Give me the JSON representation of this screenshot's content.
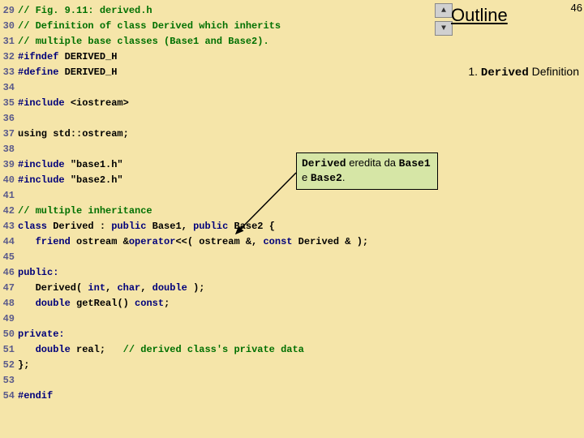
{
  "page_number": "46",
  "outline": {
    "title": "Outline"
  },
  "note1": {
    "prefix": "1. ",
    "code": "Derived",
    "suffix": " Definition"
  },
  "callout": {
    "w1": "Derived",
    "t1": " eredita da ",
    "w2": "Base1",
    "t2": " e ",
    "w3": "Base2",
    "t3": "."
  },
  "lines": {
    "l29": "// Fig. 9.11: derived.h",
    "l30": "// Definition of class Derived which inherits",
    "l31": "// multiple base classes (Base1 and Base2).",
    "l32a": "#ifndef ",
    "l32b": "DERIVED_H",
    "l33a": "#define ",
    "l33b": "DERIVED_H",
    "l35a": "#include ",
    "l35b": "<iostream>",
    "l37a": "using ",
    "l37b": "std::ostream;",
    "l39a": "#include ",
    "l39b": "\"base1.h\"",
    "l40a": "#include ",
    "l40b": "\"base2.h\"",
    "l42": "// multiple inheritance",
    "l43a": "class",
    "l43b": " Derived : ",
    "l43c": "public",
    "l43d": " Base1, ",
    "l43e": "public",
    "l43f": " Base2 {",
    "l44a": "   friend",
    "l44b": " ostream &",
    "l44c": "operator",
    "l44d": "<<( ostream &, ",
    "l44e": "const",
    "l44f": " Derived & );",
    "l46": "public:",
    "l47a": "   Derived( ",
    "l47b": "int",
    "l47c": ", ",
    "l47d": "char",
    "l47e": ", ",
    "l47f": "double",
    "l47g": " );",
    "l48a": "   ",
    "l48b": "double",
    "l48c": " getReal() ",
    "l48d": "const",
    "l48e": ";",
    "l50": "private:",
    "l51a": "   ",
    "l51b": "double",
    "l51c": " real;   ",
    "l51d": "// derived class's private data",
    "l52": "};",
    "l54": "#endif"
  },
  "ln": {
    "n29": "29",
    "n30": "30",
    "n31": "31",
    "n32": "32",
    "n33": "33",
    "n34": "34",
    "n35": "35",
    "n36": "36",
    "n37": "37",
    "n38": "38",
    "n39": "39",
    "n40": "40",
    "n41": "41",
    "n42": "42",
    "n43": "43",
    "n44": "44",
    "n45": "45",
    "n46": "46",
    "n47": "47",
    "n48": "48",
    "n49": "49",
    "n50": "50",
    "n51": "51",
    "n52": "52",
    "n53": "53",
    "n54": "54"
  }
}
